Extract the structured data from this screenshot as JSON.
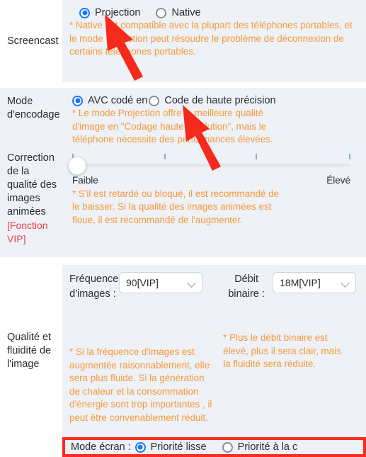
{
  "colors": {
    "panel_bg": "#eef1f6",
    "note_orange": "#f59a3c",
    "vip_red": "#ea3f4b",
    "accent_blue": "#1677ff",
    "highlight_red": "#fc2b20",
    "text": "#2b2b33"
  },
  "sections": [
    {
      "label": "Screencast",
      "radios": [
        {
          "label": "Projection",
          "selected": true
        },
        {
          "label": "Native",
          "selected": false
        }
      ],
      "note": "* Native est compatible avec la plupart des téléphones portables, et le mode Projection peut résoudre le problème de déconnexion de certains téléphones portables."
    },
    {
      "label": "Mode d'encodage",
      "radios": [
        {
          "label": "AVC codé en",
          "selected": true
        },
        {
          "label": "Code de haute précision",
          "selected": false
        }
      ],
      "note": "* Le mode Projection offre la meilleure qualité d'image en \"Codage haute résolution\", mais le téléphone nécessite des performances élevées."
    },
    {
      "label": "Correction de la qualité des images animées",
      "vip_badge": "[Fonction VIP]",
      "slider": {
        "value": 0,
        "min_label": "Faible",
        "max_label": "Élevé",
        "tick_count": 4
      },
      "note": "* S'il est retardé ou bloqué, il est recommandé de le baisser. Si la qualité des images animées est floue, il est recommandé de l'augmenter."
    },
    {
      "label": "Qualité et fluidité de l'image",
      "fields": [
        {
          "label": "Fréquence d'images :",
          "value": "90[VIP]",
          "note": "* Si la fréquence d'images est augmentée raisonnablement, elle sera plus fluide. Si la génération de chaleur et la consommation d'énergie sont trop importantes , il peut être convenablement réduit."
        },
        {
          "label": "Débit binaire :",
          "value": "18M[VIP]",
          "note": "* Plus le débit binaire est élevé, plus il sera clair, mais la fluidité sera réduite."
        }
      ]
    }
  ],
  "bottom_bar": {
    "label": "Mode écran :",
    "radios": [
      {
        "label": "Priorité lisse",
        "selected": true
      },
      {
        "label": "Priorité à la c",
        "selected": false
      }
    ]
  },
  "annotations": [
    {
      "name": "red-arrow-top",
      "points_to": "Projection radio"
    },
    {
      "name": "red-arrow-middle",
      "points_to": "AVC codé en radio"
    }
  ]
}
